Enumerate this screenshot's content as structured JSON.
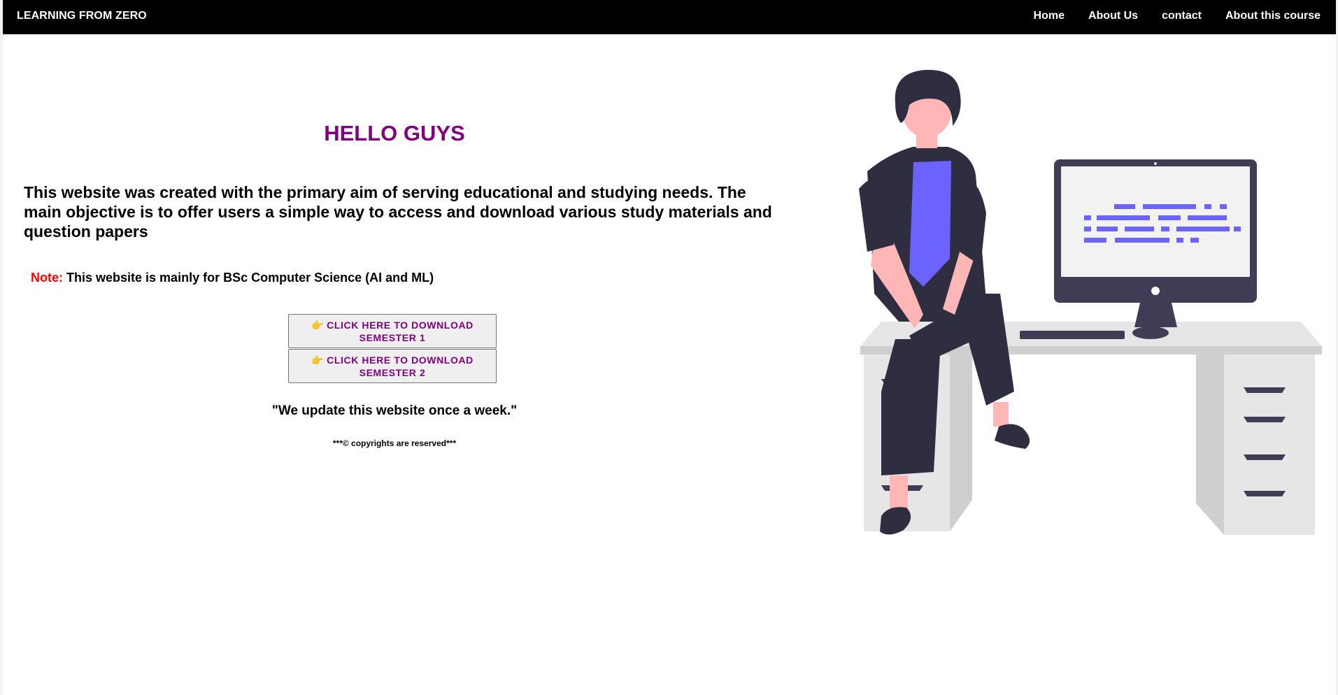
{
  "navbar": {
    "brand": "LEARNING FROM ZERO",
    "links": [
      "Home",
      "About Us",
      "contact",
      "About this course"
    ]
  },
  "main": {
    "heading": "HELLO GUYS",
    "intro": "This website was created with the primary aim of serving educational and studying needs. The main objective is to offer users a simple way to access and download various study materials and question papers",
    "note_label": "Note:",
    "note_text": "This website is mainly for BSc Computer Science (AI and ML)",
    "buttons": [
      {
        "icon": "pointing-hand-icon",
        "label": "CLICK HERE TO DOWNLOAD SEMESTER 1"
      },
      {
        "icon": "pointing-hand-icon",
        "label": "CLICK HERE TO DOWNLOAD SEMESTER 2"
      }
    ],
    "update_text": "\"We update this website once a week.\"",
    "copyright": "***© copyrights are reserved***"
  },
  "illustration": {
    "icon": "person-sitting-at-desk-illustration",
    "colors": {
      "dark": "#2f2e41",
      "skin": "#ffb6b6",
      "accent": "#6c63ff",
      "desk": "#e6e6e6",
      "desk_shadow": "#cfcfcf",
      "screen": "#f2f2f2"
    }
  },
  "colors": {
    "navbar_bg": "#000000",
    "heading": "#800080",
    "note_label": "#ff0000",
    "button_text": "#800080"
  }
}
